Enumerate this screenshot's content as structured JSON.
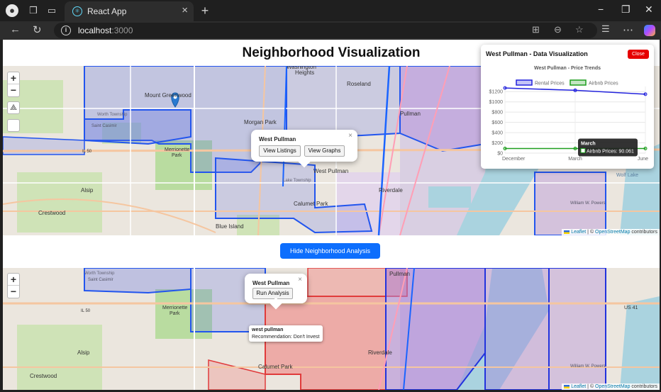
{
  "browser": {
    "tab_title": "React App",
    "url_host": "localhost",
    "url_port": ":3000"
  },
  "page": {
    "title": "Neighborhood Visualization",
    "toggle_button": "Hide Neighborhood Analysis"
  },
  "map_top": {
    "zoom_in": "+",
    "zoom_out": "−",
    "popup": {
      "name": "West Pullman",
      "view_listings": "View Listings",
      "view_graphs": "View Graphs",
      "close": "×"
    },
    "place_labels": [
      {
        "text": "Washington Heights",
        "bind": "wh"
      },
      {
        "text": "Roseland"
      },
      {
        "text": "Mount Greenwood"
      },
      {
        "text": "Worth Township"
      },
      {
        "text": "Morgan Park"
      },
      {
        "text": "Merrionette Park"
      },
      {
        "text": "West Pullman"
      },
      {
        "text": "Pullman"
      },
      {
        "text": "Alsip"
      },
      {
        "text": "Riverdale"
      },
      {
        "text": "Calumet Park"
      },
      {
        "text": "Crestwood"
      },
      {
        "text": "Blue Island"
      },
      {
        "text": "Lake Township"
      },
      {
        "text": "Wolf Lake"
      },
      {
        "text": "IL 50"
      },
      {
        "text": "Saint Casimir Lithuanian Cemetery"
      },
      {
        "text": "William W. Powers State Recreation Area"
      }
    ],
    "attribution": {
      "leaflet": "Leaflet",
      "sep": " | © ",
      "osm": "OpenStreetMap",
      "tail": " contributors"
    }
  },
  "map_bottom": {
    "zoom_in": "+",
    "zoom_out": "−",
    "popup": {
      "name": "West Pullman",
      "run_analysis": "Run Analysis",
      "close": "×"
    },
    "tooltip": {
      "name": "west pullman",
      "recommendation": "Recommendation: Don't Invest"
    },
    "place_labels": [
      "Worth Township",
      "Merrionette Park",
      "IL 50",
      "Alsip",
      "Calumet Park",
      "Crestwood",
      "Riverdale",
      "Pullman",
      "US 41",
      "Saint Casimir Lithuanian Cemetery",
      "William W. Powers State Recreation Area"
    ],
    "attribution": {
      "leaflet": "Leaflet",
      "sep": " | © ",
      "osm": "OpenStreetMap",
      "tail": " contributors"
    }
  },
  "chart_panel": {
    "title": "West Pullman - Data Visualization",
    "close": "Close"
  },
  "chart_data": {
    "type": "line",
    "title": "West Pullman - Price Trends",
    "categories": [
      "December",
      "March",
      "June"
    ],
    "series": [
      {
        "name": "Rental Prices",
        "values": [
          1270,
          1225,
          1150
        ],
        "color": "#2222dd"
      },
      {
        "name": "Airbnb Prices",
        "values": [
          90,
          90.061,
          90
        ],
        "color": "#1e9e1e"
      }
    ],
    "y_ticks": [
      "$1200",
      "$1000",
      "$800",
      "$600",
      "$400",
      "$200",
      "$0"
    ],
    "ylim": [
      0,
      1300
    ],
    "legend_position": "top",
    "tooltip": {
      "title": "March",
      "label": "Airbnb Prices: 90.061"
    }
  },
  "colors": {
    "primary_button": "#0d6efd",
    "close_button": "#e60000",
    "region_blue": "#5a6ee6",
    "region_red": "#f08080",
    "region_purple": "#a070d8"
  }
}
